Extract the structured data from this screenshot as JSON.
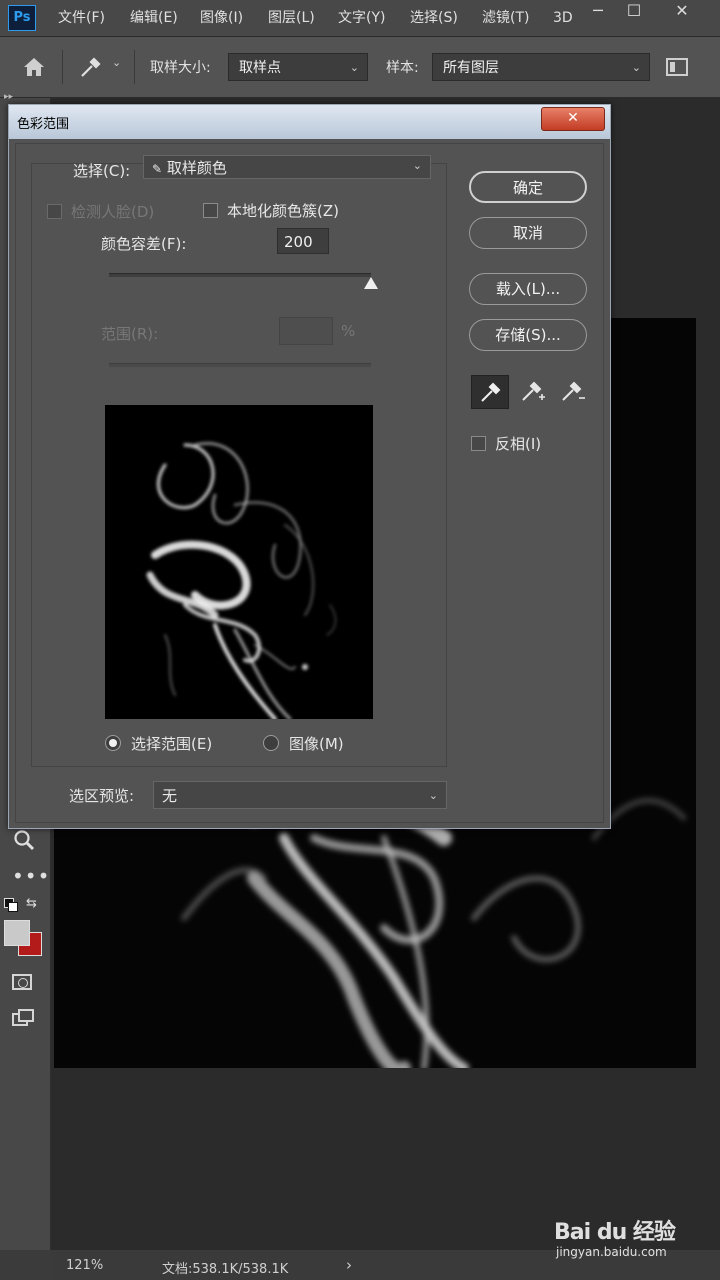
{
  "app": {
    "logo": "Ps"
  },
  "menu": [
    "文件(F)",
    "编辑(E)",
    "图像(I)",
    "图层(L)",
    "文字(Y)",
    "选择(S)",
    "滤镜(T)",
    "3D"
  ],
  "window_controls": {
    "minimize": "─",
    "maximize": "☐",
    "close": "✕"
  },
  "options_bar": {
    "sample_size_label": "取样大小:",
    "sample_size_value": "取样点",
    "sample_label": "样本:",
    "sample_value": "所有图层"
  },
  "dialog": {
    "title": "色彩范围",
    "close_glyph": "✕",
    "select_label": "选择(C):",
    "select_value": "取样颜色",
    "detect_faces": "检测人脸(D)",
    "localized": "本地化颜色簇(Z)",
    "fuzziness_label": "颜色容差(F):",
    "fuzziness_value": "200",
    "fuzziness_fraction": 1.0,
    "range_label": "范围(R):",
    "range_unit": "%",
    "radio_selection": "选择范围(E)",
    "radio_image": "图像(M)",
    "preview_label": "选区预览:",
    "preview_value": "无",
    "buttons": {
      "ok": "确定",
      "cancel": "取消",
      "load": "载入(L)...",
      "save": "存储(S)..."
    },
    "invert": "反相(I)"
  },
  "status": {
    "zoom": "121%",
    "doc": "文档:538.1K/538.1K",
    "arrow": "›"
  },
  "watermark": {
    "brand": "Bai du 经验",
    "url": "jingyan.baidu.com"
  },
  "colors": {
    "foreground": "#c9c9c9",
    "background": "#b31a1a",
    "accent": "#2c9bf0"
  }
}
